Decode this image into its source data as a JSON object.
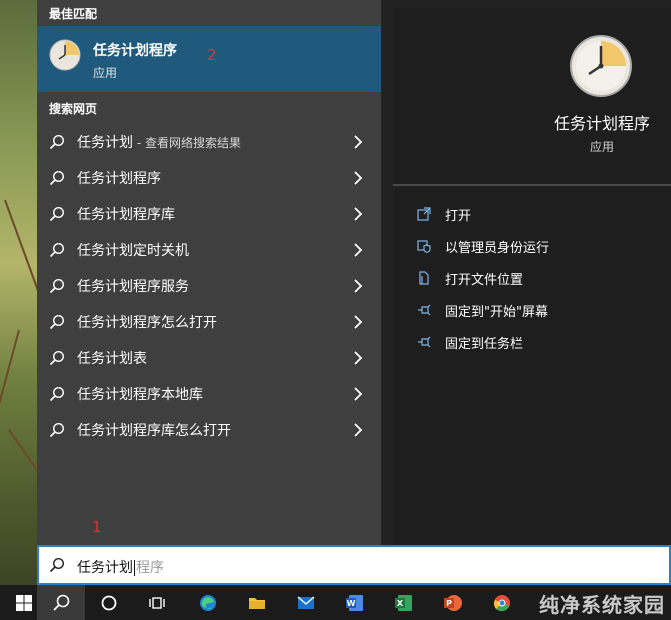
{
  "best_match": {
    "title": "最佳匹配",
    "app_name": "任务计划程序",
    "app_type": "应用",
    "annotation": "2"
  },
  "web_search": {
    "title": "搜索网页",
    "items": [
      {
        "label": "任务计划",
        "sub": " - 查看网络搜索结果"
      },
      {
        "label": "任务计划程序",
        "sub": ""
      },
      {
        "label": "任务计划程序库",
        "sub": ""
      },
      {
        "label": "任务计划定时关机",
        "sub": ""
      },
      {
        "label": "任务计划程序服务",
        "sub": ""
      },
      {
        "label": "任务计划程序怎么打开",
        "sub": ""
      },
      {
        "label": "任务计划表",
        "sub": ""
      },
      {
        "label": "任务计划程序本地库",
        "sub": ""
      },
      {
        "label": "任务计划程序库怎么打开",
        "sub": ""
      }
    ]
  },
  "preview": {
    "app_name": "任务计划程序",
    "app_type": "应用",
    "actions": [
      {
        "label": "打开",
        "icon": "open-icon"
      },
      {
        "label": "以管理员身份运行",
        "icon": "shield-icon"
      },
      {
        "label": "打开文件位置",
        "icon": "file-location-icon"
      },
      {
        "label": "固定到\"开始\"屏幕",
        "icon": "pin-icon"
      },
      {
        "label": "固定到任务栏",
        "icon": "pin-icon"
      }
    ]
  },
  "search": {
    "typed": "任务计划",
    "suggestion": "程序",
    "annotation": "1"
  },
  "watermark": "纯净系统家园",
  "colors": {
    "accent": "#2b7fc3",
    "highlight": "#1f5a7c",
    "annotation": "#e0312f"
  }
}
